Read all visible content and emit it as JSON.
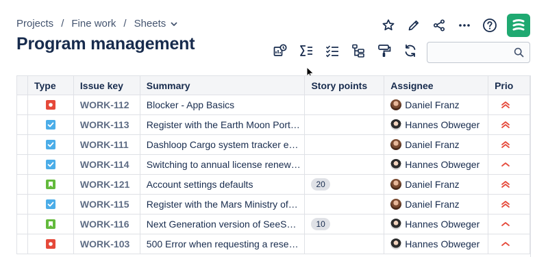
{
  "breadcrumb": {
    "items": [
      "Projects",
      "Fine work",
      "Sheets"
    ],
    "separator": "/"
  },
  "page_title": "Program management",
  "top_actions": [
    "star-icon",
    "edit-icon",
    "share-icon",
    "more-icon",
    "help-icon",
    "app-logo"
  ],
  "toolbar": [
    "overview-icon",
    "sum-icon",
    "checklist-icon",
    "hierarchy-icon",
    "format-paint-icon",
    "refresh-icon"
  ],
  "search": {
    "value": "",
    "placeholder": ""
  },
  "table": {
    "headers": {
      "type": "Type",
      "key": "Issue key",
      "summary": "Summary",
      "story_points": "Story points",
      "assignee": "Assignee",
      "prio": "Prio"
    },
    "rows": [
      {
        "type": "bug",
        "key": "WORK-112",
        "summary": "Blocker - App Basics",
        "story_points": "",
        "assignee": "Daniel Franz",
        "avatar": "af",
        "priority": "high"
      },
      {
        "type": "task",
        "key": "WORK-113",
        "summary": "Register with the Earth Moon Port…",
        "story_points": "",
        "assignee": "Hannes Obweger",
        "avatar": "ah",
        "priority": "high"
      },
      {
        "type": "task",
        "key": "WORK-111",
        "summary": "Dashloop Cargo system tracker e…",
        "story_points": "",
        "assignee": "Daniel Franz",
        "avatar": "af",
        "priority": "high"
      },
      {
        "type": "task",
        "key": "WORK-114",
        "summary": "Switching to annual license renew…",
        "story_points": "",
        "assignee": "Hannes Obweger",
        "avatar": "ah",
        "priority": "medium"
      },
      {
        "type": "story",
        "key": "WORK-121",
        "summary": "Account settings defaults",
        "story_points": "20",
        "assignee": "Daniel Franz",
        "avatar": "af",
        "priority": "high"
      },
      {
        "type": "task",
        "key": "WORK-115",
        "summary": "Register with the Mars Ministry of…",
        "story_points": "",
        "assignee": "Daniel Franz",
        "avatar": "af",
        "priority": "high"
      },
      {
        "type": "story",
        "key": "WORK-116",
        "summary": "Next Generation version of SeeSp…",
        "story_points": "10",
        "assignee": "Hannes Obweger",
        "avatar": "ah",
        "priority": "medium"
      },
      {
        "type": "bug",
        "key": "WORK-103",
        "summary": "500 Error when requesting a rese…",
        "story_points": "",
        "assignee": "Hannes Obweger",
        "avatar": "ah",
        "priority": "medium"
      }
    ]
  },
  "colors": {
    "accent": "#1fa971",
    "bug": "#e5493a",
    "task": "#4bade8",
    "story": "#63ba3c",
    "priority": "#e5493a"
  }
}
